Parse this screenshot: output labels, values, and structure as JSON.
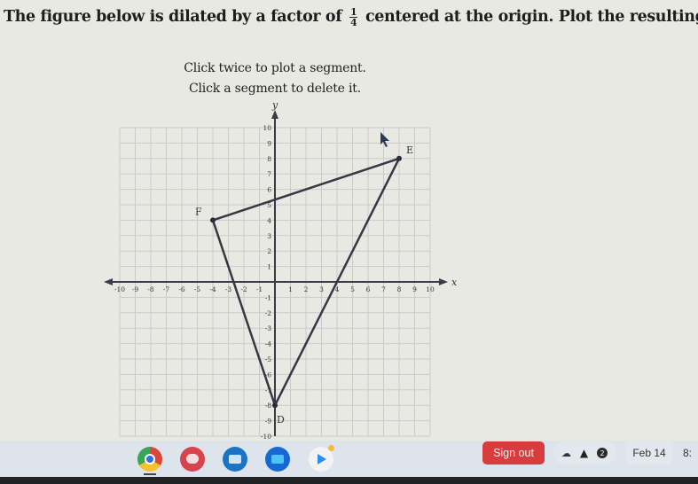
{
  "question": {
    "text_before": "The figure below is dilated by a factor of",
    "fraction_numerator": "1",
    "fraction_denominator": "4",
    "text_after": "centered at the origin. Plot the resulting image."
  },
  "instructions": {
    "line1": "Click twice to plot a segment.",
    "line2": "Click a segment to delete it."
  },
  "chart_data": {
    "type": "scatter",
    "title": "",
    "xlabel": "x",
    "ylabel": "y",
    "xlim": [
      -10,
      10
    ],
    "ylim": [
      -10,
      10
    ],
    "grid": true,
    "x_ticks": [
      -10,
      -9,
      -8,
      -7,
      -6,
      -5,
      -4,
      -3,
      -2,
      -1,
      1,
      2,
      3,
      4,
      5,
      6,
      7,
      8,
      9,
      10
    ],
    "y_ticks": [
      -10,
      -9,
      -8,
      -7,
      -6,
      -5,
      -4,
      -3,
      -2,
      -1,
      1,
      2,
      3,
      4,
      5,
      6,
      7,
      8,
      9,
      10
    ],
    "points": [
      {
        "label": "E",
        "x": 8,
        "y": 8
      },
      {
        "label": "F",
        "x": -4,
        "y": 4
      },
      {
        "label": "D",
        "x": 0,
        "y": -8
      }
    ],
    "segments": [
      [
        "F",
        "E"
      ],
      [
        "E",
        "D"
      ],
      [
        "D",
        "F"
      ]
    ]
  },
  "taskbar": {
    "apps": [
      {
        "name": "chrome"
      },
      {
        "name": "canvas"
      },
      {
        "name": "classroom"
      },
      {
        "name": "files"
      },
      {
        "name": "play-store"
      }
    ],
    "sign_out_label": "Sign out",
    "notification_count": "2",
    "date": "Feb 14",
    "time": "8:"
  }
}
